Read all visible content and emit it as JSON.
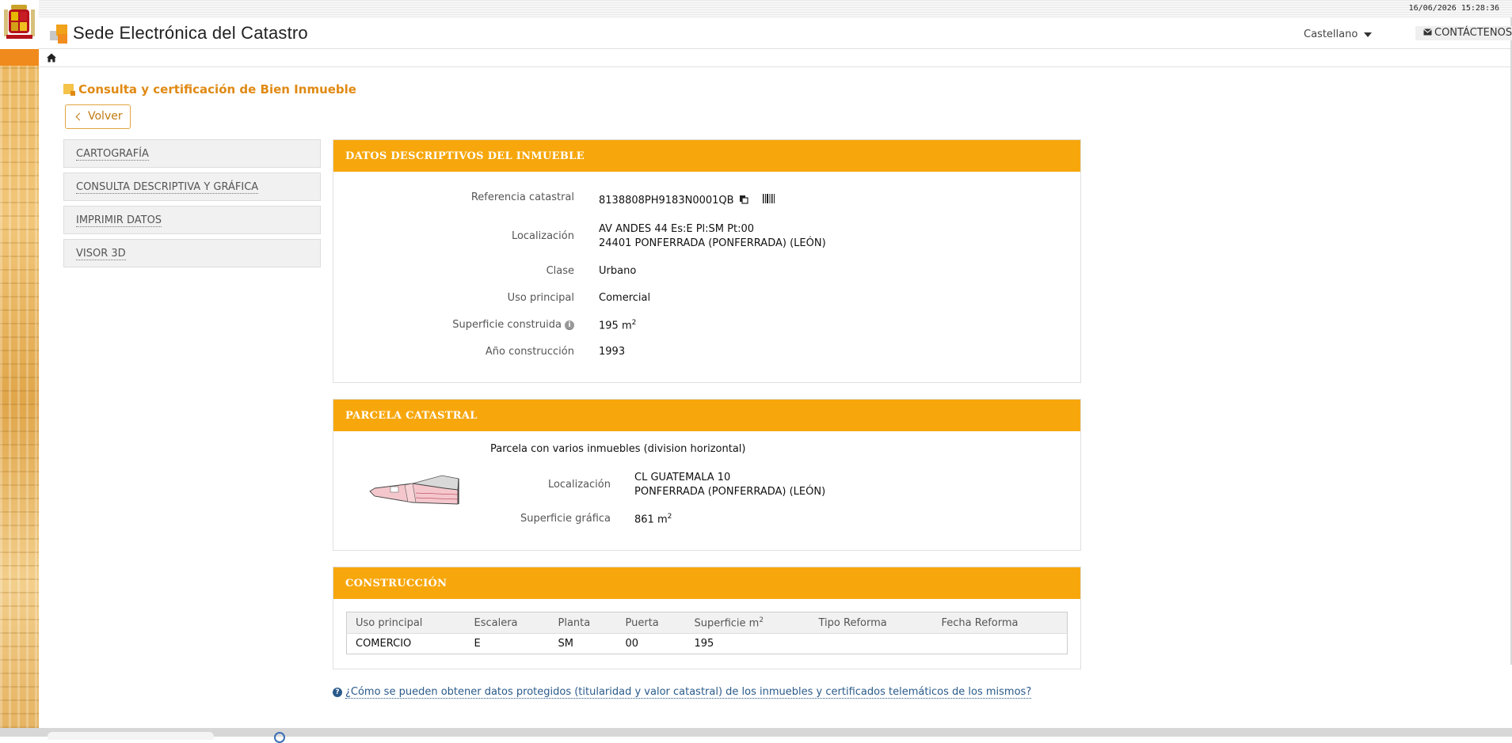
{
  "header": {
    "datetime": "16/06/2026  15:28:36",
    "site_title": "Sede Electrónica del Catastro",
    "language": "Castellano",
    "contact_label": "CONTÁCTENOS"
  },
  "page": {
    "heading": "Consulta y certificación de Bien Inmueble",
    "back_label": "Volver"
  },
  "menu": {
    "items": [
      {
        "label": "CARTOGRAFÍA"
      },
      {
        "label": "CONSULTA DESCRIPTIVA Y GRÁFICA"
      },
      {
        "label": "IMPRIMIR DATOS"
      },
      {
        "label": "VISOR 3D"
      }
    ]
  },
  "datos": {
    "title": "DATOS DESCRIPTIVOS DEL INMUEBLE",
    "ref_label": "Referencia catastral",
    "ref_value": "8138808PH9183N0001QB",
    "loc_label": "Localización",
    "loc_line1": "AV ANDES 44 Es:E Pl:SM Pt:00",
    "loc_line2": "24401 PONFERRADA (PONFERRADA) (LEÓN)",
    "clase_label": "Clase",
    "clase_value": "Urbano",
    "uso_label": "Uso principal",
    "uso_value": "Comercial",
    "sup_label": "Superficie construida",
    "sup_value": "195 m",
    "sup_unit_exp": "2",
    "anio_label": "Año construcción",
    "anio_value": "1993"
  },
  "parcela": {
    "title": "PARCELA CATASTRAL",
    "subtitle": "Parcela con varios inmuebles (division horizontal)",
    "loc_label": "Localización",
    "loc_line1": "CL GUATEMALA 10",
    "loc_line2": "PONFERRADA (PONFERRADA) (LEÓN)",
    "sup_label": "Superficie gráfica",
    "sup_value": "861 m",
    "sup_unit_exp": "2"
  },
  "construccion": {
    "title": "CONSTRUCCIÓN",
    "columns": [
      "Uso principal",
      "Escalera",
      "Planta",
      "Puerta",
      "Superficie m",
      "Tipo Reforma",
      "Fecha Reforma"
    ],
    "sup_col_exp": "2",
    "rows": [
      [
        "COMERCIO",
        "E",
        "SM",
        "00",
        "195",
        "",
        ""
      ]
    ]
  },
  "help": {
    "link_text": "¿Cómo se pueden obtener datos protegidos (titularidad y valor catastral) de los inmuebles y certificados telemáticos de los mismos?"
  }
}
